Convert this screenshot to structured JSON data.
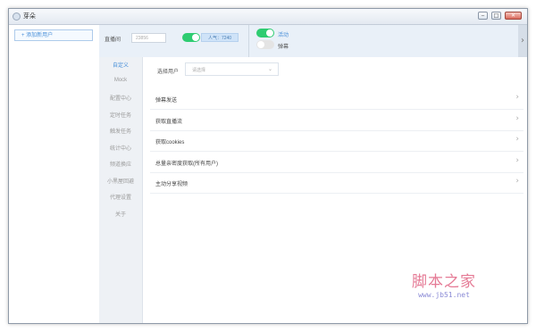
{
  "window": {
    "title": "芽朵"
  },
  "sidebar": {
    "add_user_label": "+ 添加新用户"
  },
  "topbar": {
    "room_label": "直播间",
    "room_input_value": "23856",
    "popularity_label": "人气：7240",
    "live_label": "活动",
    "barrage_label": "弹幕",
    "collapse_icon": "›"
  },
  "nav": {
    "items": [
      {
        "label": "自定义",
        "active": true
      },
      {
        "label": "Mock"
      },
      {
        "label": "配置中心"
      },
      {
        "label": "定时任务"
      },
      {
        "label": "触发任务"
      },
      {
        "label": "统计中心"
      },
      {
        "label": "频道换应"
      },
      {
        "label": "小黑屋回避"
      },
      {
        "label": "代理设置"
      },
      {
        "label": "关于"
      }
    ]
  },
  "main": {
    "select_user_label": "选择用户",
    "select_placeholder": "请选择",
    "rows": [
      {
        "label": "弹幕发送"
      },
      {
        "label": "获取直播流"
      },
      {
        "label": "获取cookies"
      },
      {
        "label": "总量亲密度获取(所有用户)"
      },
      {
        "label": "主动分享视频"
      }
    ]
  },
  "watermark": {
    "text": "脚本之家",
    "url": "www.jb51.net"
  },
  "colors": {
    "accent": "#4a90d9",
    "toggle_on": "#2ecc71",
    "watermark": "#e57a95"
  }
}
